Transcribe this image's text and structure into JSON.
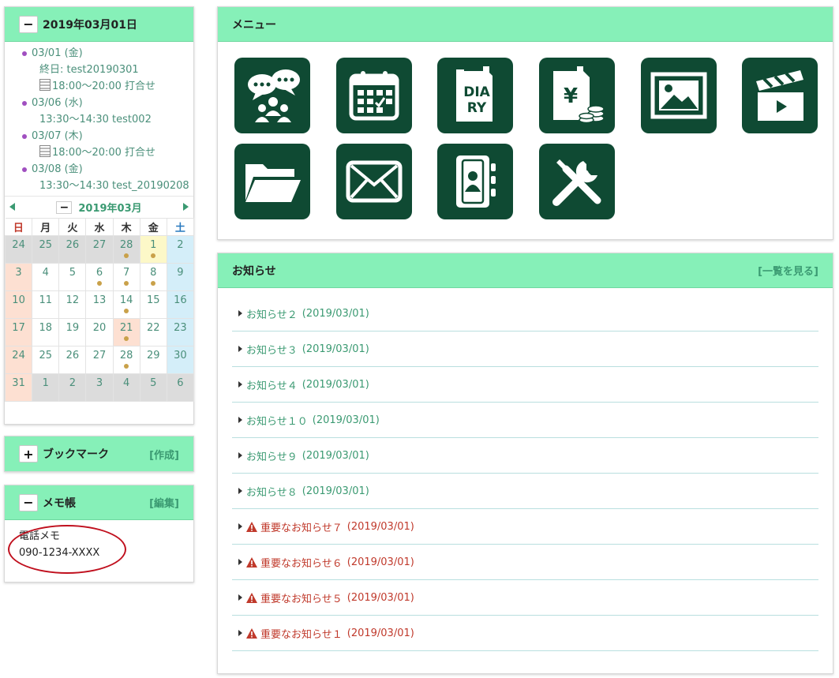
{
  "schedule": {
    "header": "2019年03月01日",
    "toggle": "−",
    "items": [
      {
        "date": "03/01 (金)",
        "events": [
          {
            "icon": "",
            "text": "終日: test20190301"
          },
          {
            "icon": "building",
            "text": "18:00～20:00 打合せ"
          }
        ]
      },
      {
        "date": "03/06 (水)",
        "events": [
          {
            "icon": "",
            "text": "13:30～14:30 test002"
          }
        ]
      },
      {
        "date": "03/07 (木)",
        "events": [
          {
            "icon": "building",
            "text": "18:00～20:00 打合せ"
          }
        ]
      },
      {
        "date": "03/08 (金)",
        "events": [
          {
            "icon": "",
            "text": "13:30～14:30 test_20190208"
          }
        ]
      }
    ]
  },
  "calendar": {
    "month": "2019年03月",
    "toggle": "−",
    "weekdays": [
      "日",
      "月",
      "火",
      "水",
      "木",
      "金",
      "土"
    ],
    "weeks": [
      [
        {
          "d": "24",
          "k": "other"
        },
        {
          "d": "25",
          "k": "other"
        },
        {
          "d": "26",
          "k": "other"
        },
        {
          "d": "27",
          "k": "other"
        },
        {
          "d": "28",
          "k": "other",
          "dot": true
        },
        {
          "d": "1",
          "k": "today",
          "dot": true
        },
        {
          "d": "2",
          "k": "sat"
        }
      ],
      [
        {
          "d": "3",
          "k": "sun"
        },
        {
          "d": "4"
        },
        {
          "d": "5"
        },
        {
          "d": "6",
          "dot": true
        },
        {
          "d": "7",
          "dot": true
        },
        {
          "d": "8",
          "dot": true
        },
        {
          "d": "9",
          "k": "sat"
        }
      ],
      [
        {
          "d": "10",
          "k": "sun"
        },
        {
          "d": "11"
        },
        {
          "d": "12"
        },
        {
          "d": "13"
        },
        {
          "d": "14",
          "dot": true
        },
        {
          "d": "15"
        },
        {
          "d": "16",
          "k": "sat"
        }
      ],
      [
        {
          "d": "17",
          "k": "sun"
        },
        {
          "d": "18"
        },
        {
          "d": "19"
        },
        {
          "d": "20"
        },
        {
          "d": "21",
          "k": "hol",
          "dot": true
        },
        {
          "d": "22"
        },
        {
          "d": "23",
          "k": "sat"
        }
      ],
      [
        {
          "d": "24",
          "k": "sun"
        },
        {
          "d": "25"
        },
        {
          "d": "26"
        },
        {
          "d": "27"
        },
        {
          "d": "28",
          "dot": true
        },
        {
          "d": "29"
        },
        {
          "d": "30",
          "k": "sat"
        }
      ],
      [
        {
          "d": "31",
          "k": "sun"
        },
        {
          "d": "1",
          "k": "other"
        },
        {
          "d": "2",
          "k": "other"
        },
        {
          "d": "3",
          "k": "other"
        },
        {
          "d": "4",
          "k": "other"
        },
        {
          "d": "5",
          "k": "other"
        },
        {
          "d": "6",
          "k": "other"
        }
      ]
    ]
  },
  "bookmark": {
    "title": "ブックマーク",
    "toggle": "+",
    "action": "[作成]"
  },
  "memo": {
    "title": "メモ帳",
    "toggle": "−",
    "action": "[編集]",
    "lines": [
      "電話メモ",
      "090-1234-XXXX"
    ]
  },
  "menu": {
    "title": "メニュー",
    "tiles": [
      "chat-icon",
      "calendar-icon",
      "diary-icon",
      "expense-icon",
      "image-icon",
      "video-icon",
      "folder-icon",
      "mail-icon",
      "addressbook-icon",
      "tools-icon"
    ],
    "diary_text": [
      "DIA",
      "RY"
    ],
    "yen": "¥",
    "tile_color": "#0f4a33"
  },
  "news": {
    "title": "お知らせ",
    "action": "[一覧を見る]",
    "items": [
      {
        "title": "お知らせ２",
        "date": "(2019/03/01)",
        "important": false
      },
      {
        "title": "お知らせ３",
        "date": "(2019/03/01)",
        "important": false
      },
      {
        "title": "お知らせ４",
        "date": "(2019/03/01)",
        "important": false
      },
      {
        "title": "お知らせ１０",
        "date": "(2019/03/01)",
        "important": false
      },
      {
        "title": "お知らせ９",
        "date": "(2019/03/01)",
        "important": false
      },
      {
        "title": "お知らせ８",
        "date": "(2019/03/01)",
        "important": false
      },
      {
        "title": "重要なお知らせ７",
        "date": "(2019/03/01)",
        "important": true
      },
      {
        "title": "重要なお知らせ６",
        "date": "(2019/03/01)",
        "important": true
      },
      {
        "title": "重要なお知らせ５",
        "date": "(2019/03/01)",
        "important": true
      },
      {
        "title": "重要なお知らせ１",
        "date": "(2019/03/01)",
        "important": true
      }
    ]
  },
  "colors": {
    "header": "#86f0b8",
    "link": "#3b9a72",
    "important": "#c0392b"
  }
}
